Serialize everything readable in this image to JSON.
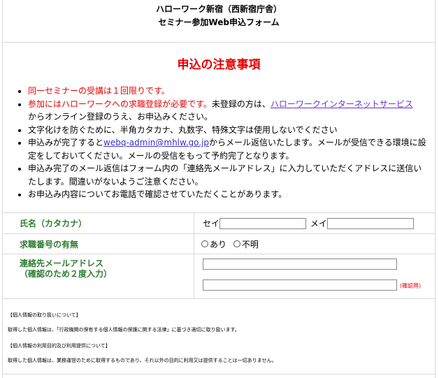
{
  "header": {
    "line1": "ハローワーク新宿（西新宿庁舎）",
    "line2": "セミナー参加Web申込フォーム"
  },
  "notice": {
    "title": "申込の注意事項",
    "items": [
      "同一セミナーの受講は１回限りです。",
      "参加にはハローワークへの求職登録が必要です。",
      "未登録の方は、",
      "ハローワークインターネットサービス",
      "からオンライン登録のうえ、お申込みください。",
      "文字化けを防ぐために、半角カタカナ、丸数字、特殊文字は使用しないでください",
      "申込みが完了すると",
      "webq-admin@mhlw.go.jp",
      "からメール返信いたします。メールが受信できる環境に設定をしておいてください。メールの受信をもって予約完了となります。",
      "申込み完了のメール返信はフォーム内の「連絡先メールアドレス」に入力していただくアドレスに送信いたします。間違いがないようご注意ください。",
      "お申込み内容についてお電話で確認させていただくことがあります。"
    ]
  },
  "form": {
    "name_label": "氏名（カタカナ）",
    "sei": "セイ",
    "mei": "メイ",
    "job_label": "求職番号の有無",
    "opt_yes": "あり",
    "opt_no": "不明",
    "email_label1": "連絡先メールアドレス",
    "email_label2": "（確認のため２度入力）",
    "confirm_note": "(確認用)"
  },
  "privacy": {
    "h1": "【個人情報の取り扱いについて】",
    "p1": "取得した個人情報は、「行政機関の保有する個人情報の保護に関する法律」に基づき適切に取り扱います。",
    "h2": "【個人情報の利用目的及び利用提供について】",
    "p2": "取得した個人情報は、業務運営のために取得するものであり、それ以外の目的に利用又は提供することは一切ありません。"
  }
}
